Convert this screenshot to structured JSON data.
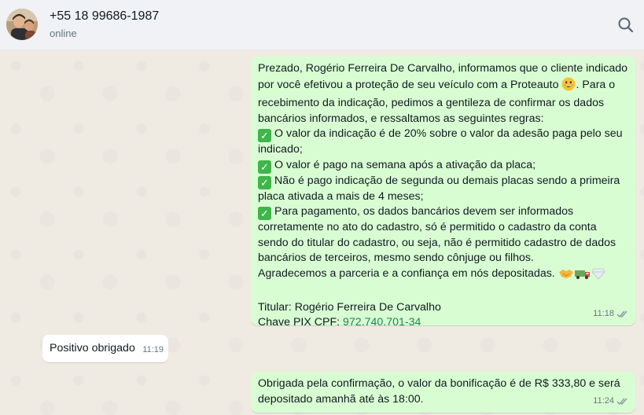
{
  "header": {
    "contact_name": "+55 18 99686-1987",
    "status": "online",
    "search_icon": "search-icon"
  },
  "colors": {
    "outgoing_bubble": "#d9fdd3",
    "incoming_bubble": "#ffffff",
    "chat_background": "#efeae2",
    "check_emoji": "#3fb54a"
  },
  "messages": [
    {
      "direction": "outgoing",
      "lines": {
        "l1": "Prezado, Rogério Ferreira De Carvalho, informamos que o cliente indicado",
        "l2a": "por você efetivou a proteção de seu veículo com a Proteauto ",
        "l2b": ". Para o",
        "l3": "recebimento da indicação, pedimos a gentileza de confirmar os dados",
        "l4": "bancários informados, e  ressaltamos as seguintes regras:",
        "l5": "O valor da indicação é de 20% sobre o valor da adesão paga pelo seu",
        "l6": "indicado;",
        "l7": "O valor é pago na semana após a ativação da placa;",
        "l8": "Não é pago indicação de segunda ou demais placas sendo a primeira",
        "l9": "placa ativada a mais de 4 meses;",
        "l10": "Para pagamento, os dados bancários devem ser informados",
        "l11": "corretamente no ato do cadastro, só é permitido o cadastro da conta",
        "l12": "sendo do titular do cadastro, ou seja, não é permitido cadastro de dados",
        "l13": "bancários de terceiros, mesmo sendo cônjuge ou filhos.",
        "l14": "Agradecemos a parceria e a confiança em nós depositadas. ",
        "l15": "Titular: Rogério Ferreira De Carvalho",
        "l16a": "Chave PIX CPF: ",
        "l16b": "972.740.701-34"
      },
      "time": "11:18",
      "status_icon": "double-check-icon"
    },
    {
      "direction": "incoming",
      "text": "Positivo obrigado",
      "time": "11:19"
    },
    {
      "direction": "outgoing",
      "l1": "Obrigada pela confirmação, o valor da bonificação é de R$ 333,80 e será",
      "l2": "depositado amanhã até às 18:00.",
      "time": "11:24",
      "status_icon": "double-check-icon"
    }
  ]
}
